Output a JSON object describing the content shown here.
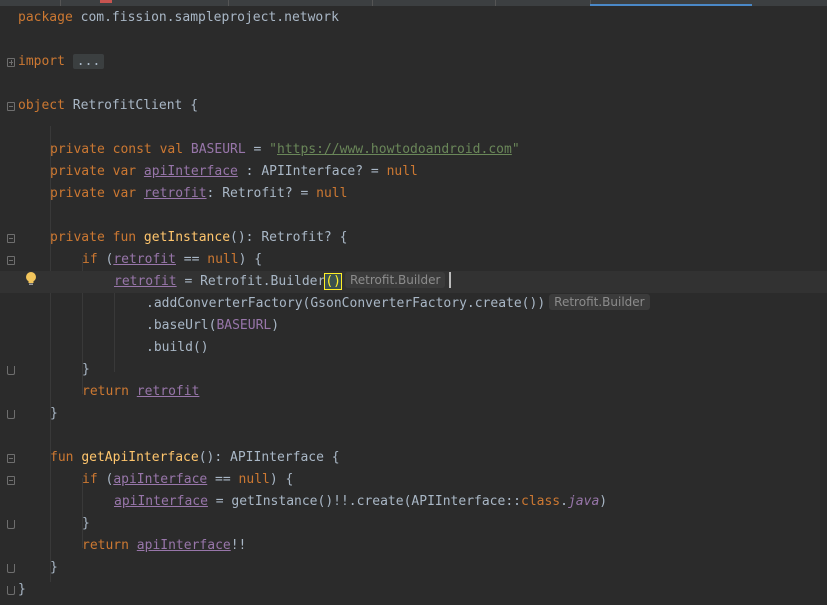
{
  "colors": {
    "background": "#2b2b2b",
    "keyword": "#cc7832",
    "function": "#ffc66d",
    "property": "#9876aa",
    "string": "#6a8759",
    "text": "#a9b7c6",
    "active_tab_underline": "#4a88c7"
  },
  "icons": {
    "fold_marker": "fold-icon",
    "intention_bulb": "bulb-icon"
  },
  "code": {
    "l1": {
      "kw": "package",
      "rest": " com.fission.sampleproject.network"
    },
    "l2": {
      "kw": "import",
      "folded": "..."
    },
    "l3": {
      "kw": "object",
      "rest": " RetrofitClient {"
    },
    "l4": {
      "kw": "private const val",
      "name": " BASEURL",
      "eq": " = ",
      "q1": "\"",
      "url": "https://www.howtodoandroid.com",
      "q2": "\""
    },
    "l5": {
      "kw": "private var",
      "prop": "apiInterface",
      "rest": " : APIInterface? = ",
      "null": "null"
    },
    "l6": {
      "kw": "private var",
      "prop": "retrofit",
      "rest": ": Retrofit? = ",
      "null": "null"
    },
    "l7": {
      "kw1": "private fun",
      "fn": "getInstance",
      "rest": "(): Retrofit? {"
    },
    "l8": {
      "kw": "if",
      "open": " (",
      "prop": "retrofit",
      "mid": " == ",
      "null": "null",
      "close": ") {"
    },
    "l9": {
      "prop": "retrofit",
      "rest": " = Retrofit.Builder",
      "paren": "()",
      "hint": "Retrofit.Builder"
    },
    "l10": {
      "text": ".addConverterFactory(GsonConverterFactory.create())",
      "hint": "Retrofit.Builder"
    },
    "l11": {
      "pre": ".baseUrl(",
      "const": "BASEURL",
      "post": ")"
    },
    "l12": {
      "text": ".build()"
    },
    "l13": {
      "text": "}"
    },
    "l14": {
      "kw": "return",
      "prop": "retrofit"
    },
    "l15": {
      "text": "}"
    },
    "l16": {
      "kw": "fun",
      "fn": "getApiInterface",
      "rest": "(): APIInterface {"
    },
    "l17": {
      "kw": "if",
      "open": " (",
      "prop": "apiInterface",
      "mid": " == ",
      "null": "null",
      "close": ") {"
    },
    "l18": {
      "prop": "apiInterface",
      "rest": " = getInstance()!!.create(APIInterface::",
      "kw": "class",
      "dot": ".",
      "italic": "java",
      "close": ")"
    },
    "l19": {
      "text": "}"
    },
    "l20": {
      "kw": "return",
      "prop": "apiInterface",
      "rest": "!!"
    },
    "l21": {
      "text": "}"
    },
    "l22": {
      "text": "}"
    }
  }
}
